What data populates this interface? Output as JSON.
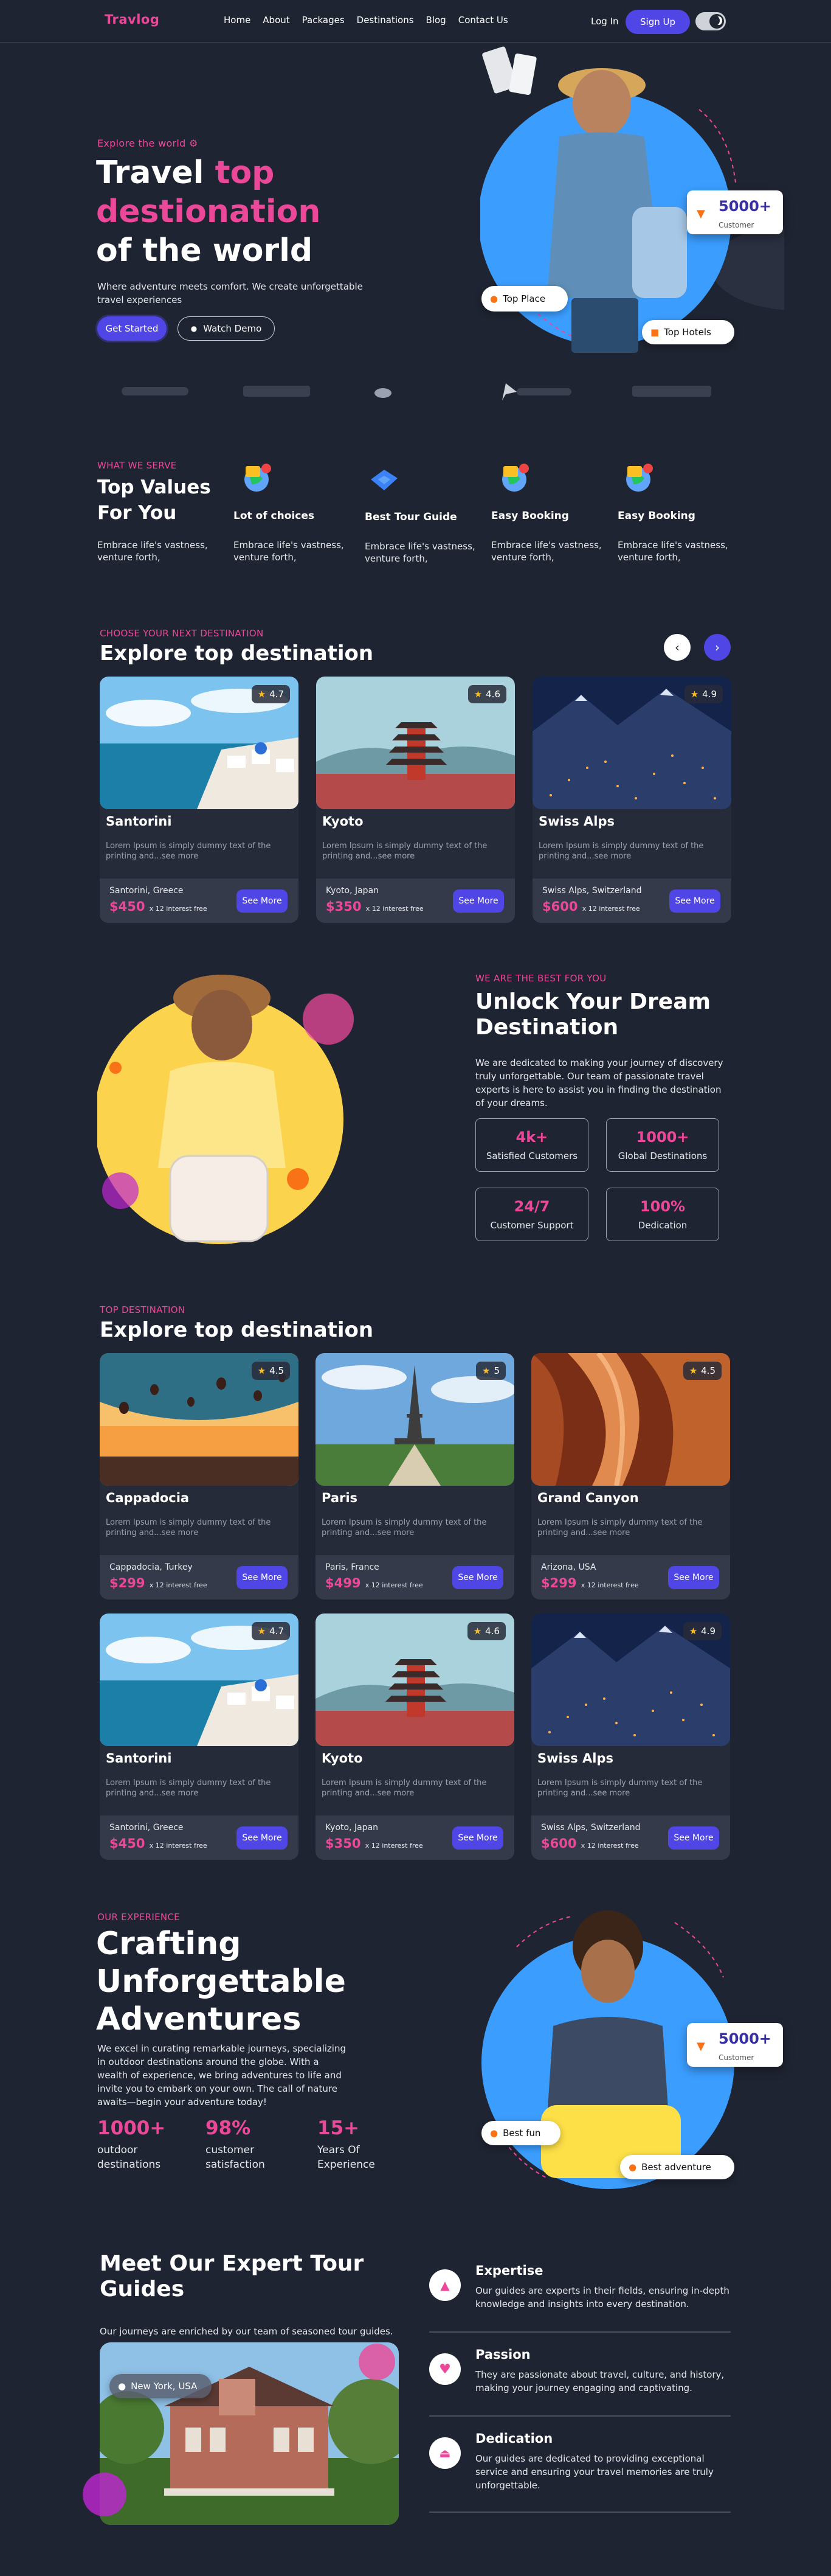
{
  "nav": {
    "logo": "Travlog",
    "links": [
      "Home",
      "About",
      "Packages",
      "Destinations",
      "Blog",
      "Contact Us"
    ],
    "login": "Log In",
    "signup": "Sign Up"
  },
  "hero": {
    "eyebrow": "Explore the world",
    "title_line1a": "Travel",
    "title_line1b": "top",
    "title_line2": "destionation",
    "title_line3": "of the world",
    "subtitle": "Where adventure meets comfort. We create unforgettable travel experiences",
    "cta_primary": "Get Started",
    "cta_secondary": "Watch Demo",
    "stat_value": "5000+",
    "stat_label": "Customer",
    "pill_place": "Top Place",
    "pill_hotels": "Top Hotels"
  },
  "values": {
    "eyebrow": "WHAT WE SERVE",
    "title_line1": "Top Values",
    "title_line2": "For You",
    "desc": "Embrace life's vastness, venture forth,",
    "items": [
      {
        "title": "Lot of choices",
        "desc": "Embrace life's vastness, venture forth,",
        "icon": "globe-compass-icon"
      },
      {
        "title": "Best Tour Guide",
        "desc": "Embrace life's vastness, venture forth,",
        "icon": "map-icon"
      },
      {
        "title": "Easy Booking",
        "desc": "Embrace life's vastness, venture forth,",
        "icon": "globe-compass-icon"
      },
      {
        "title": "Easy Booking",
        "desc": "Embrace life's vastness, venture forth,",
        "icon": "globe-compass-icon"
      }
    ]
  },
  "dest1": {
    "eyebrow": "CHOOSE YOUR NEXT DESTINATION",
    "title": "Explore top destination",
    "cards": [
      {
        "name": "Santorini",
        "rating": "4.7",
        "desc": "Lorem Ipsum is simply dummy text of the printing and...see more",
        "loc": "Santorini, Greece",
        "price": "$450",
        "interest": "x 12 interest free",
        "cta": "See More"
      },
      {
        "name": "Kyoto",
        "rating": "4.6",
        "desc": "Lorem Ipsum is simply dummy text of the printing and...see more",
        "loc": "Kyoto, Japan",
        "price": "$350",
        "interest": "x 12 interest free",
        "cta": "See More"
      },
      {
        "name": "Swiss Alps",
        "rating": "4.9",
        "desc": "Lorem Ipsum is simply dummy text of the printing and...see more",
        "loc": "Swiss Alps, Switzerland",
        "price": "$600",
        "interest": "x 12 interest free",
        "cta": "See More"
      }
    ]
  },
  "unlock": {
    "eyebrow": "WE ARE THE BEST FOR YOU",
    "title_line1": "Unlock Your Dream",
    "title_line2": "Destination",
    "desc": "We are dedicated to making your journey of discovery truly unforgettable. Our team of passionate travel experts is here to assist you in finding the destination of your dreams.",
    "stats": [
      {
        "value": "4k+",
        "label": "Satisfied Customers"
      },
      {
        "value": "1000+",
        "label": "Global Destinations"
      },
      {
        "value": "24/7",
        "label": "Customer Support"
      },
      {
        "value": "100%",
        "label": "Dedication"
      }
    ]
  },
  "dest2": {
    "eyebrow": "TOP DESTINATION",
    "title": "Explore top destination",
    "cards": [
      {
        "name": "Cappadocia",
        "rating": "4.5",
        "desc": "Lorem Ipsum is simply dummy text of the printing and...see more",
        "loc": "Cappadocia, Turkey",
        "price": "$299",
        "interest": "x 12 interest free",
        "cta": "See More"
      },
      {
        "name": "Paris",
        "rating": "5",
        "desc": "Lorem Ipsum is simply dummy text of the printing and...see more",
        "loc": "Paris, France",
        "price": "$499",
        "interest": "x 12 interest free",
        "cta": "See More"
      },
      {
        "name": "Grand Canyon",
        "rating": "4.5",
        "desc": "Lorem Ipsum is simply dummy text of the printing and...see more",
        "loc": "Arizona, USA",
        "price": "$299",
        "interest": "x 12 interest free",
        "cta": "See More"
      },
      {
        "name": "Santorini",
        "rating": "4.7",
        "desc": "Lorem Ipsum is simply dummy text of the printing and...see more",
        "loc": "Santorini, Greece",
        "price": "$450",
        "interest": "x 12 interest free",
        "cta": "See More"
      },
      {
        "name": "Kyoto",
        "rating": "4.6",
        "desc": "Lorem Ipsum is simply dummy text of the printing and...see more",
        "loc": "Kyoto, Japan",
        "price": "$350",
        "interest": "x 12 interest free",
        "cta": "See More"
      },
      {
        "name": "Swiss Alps",
        "rating": "4.9",
        "desc": "Lorem Ipsum is simply dummy text of the printing and...see more",
        "loc": "Swiss Alps, Switzerland",
        "price": "$600",
        "interest": "x 12 interest free",
        "cta": "See More"
      }
    ]
  },
  "experience": {
    "eyebrow": "OUR EXPERIENCE",
    "title_line1": "Crafting",
    "title_line2": "Unforgettable",
    "title_line3": "Adventures",
    "desc": "We excel in curating remarkable journeys, specializing in outdoor destinations around the globe. With a wealth of experience, we bring adventures to life and invite you to embark on your own. The call of nature awaits—begin your adventure today!",
    "stats": [
      {
        "value": "1000+",
        "label1": "outdoor",
        "label2": "destinations"
      },
      {
        "value": "98%",
        "label1": "customer",
        "label2": "satisfaction"
      },
      {
        "value": "15+",
        "label1": "Years Of",
        "label2": "Experience"
      }
    ],
    "stat_value": "5000+",
    "stat_label": "Customer",
    "pill_fun": "Best fun",
    "pill_adventure": "Best adventure"
  },
  "guides": {
    "title_line1": "Meet Our Expert Tour",
    "title_line2": "Guides",
    "desc": "Our journeys are enriched by our team of seasoned tour guides. Our guides bring your adventures to life with their expertise, passion",
    "location": "New York, USA",
    "items": [
      {
        "title": "Expertise",
        "desc": "Our guides are experts in their fields, ensuring in-depth knowledge and insights into every destination.",
        "icon": "thumbs-up-icon"
      },
      {
        "title": "Passion",
        "desc": "They are passionate about travel, culture, and history, making your journey engaging and captivating.",
        "icon": "heart-icon"
      },
      {
        "title": "Dedication",
        "desc": "Our guides are dedicated to providing exceptional service and ensuring your travel memories are truly unforgettable.",
        "icon": "eject-icon"
      }
    ]
  },
  "colors": {
    "accent": "#ec4899",
    "primary": "#4f46e5",
    "background": "#1f2432",
    "blue_circle": "#3b9eff",
    "yellow_circle": "#fcd34d"
  }
}
